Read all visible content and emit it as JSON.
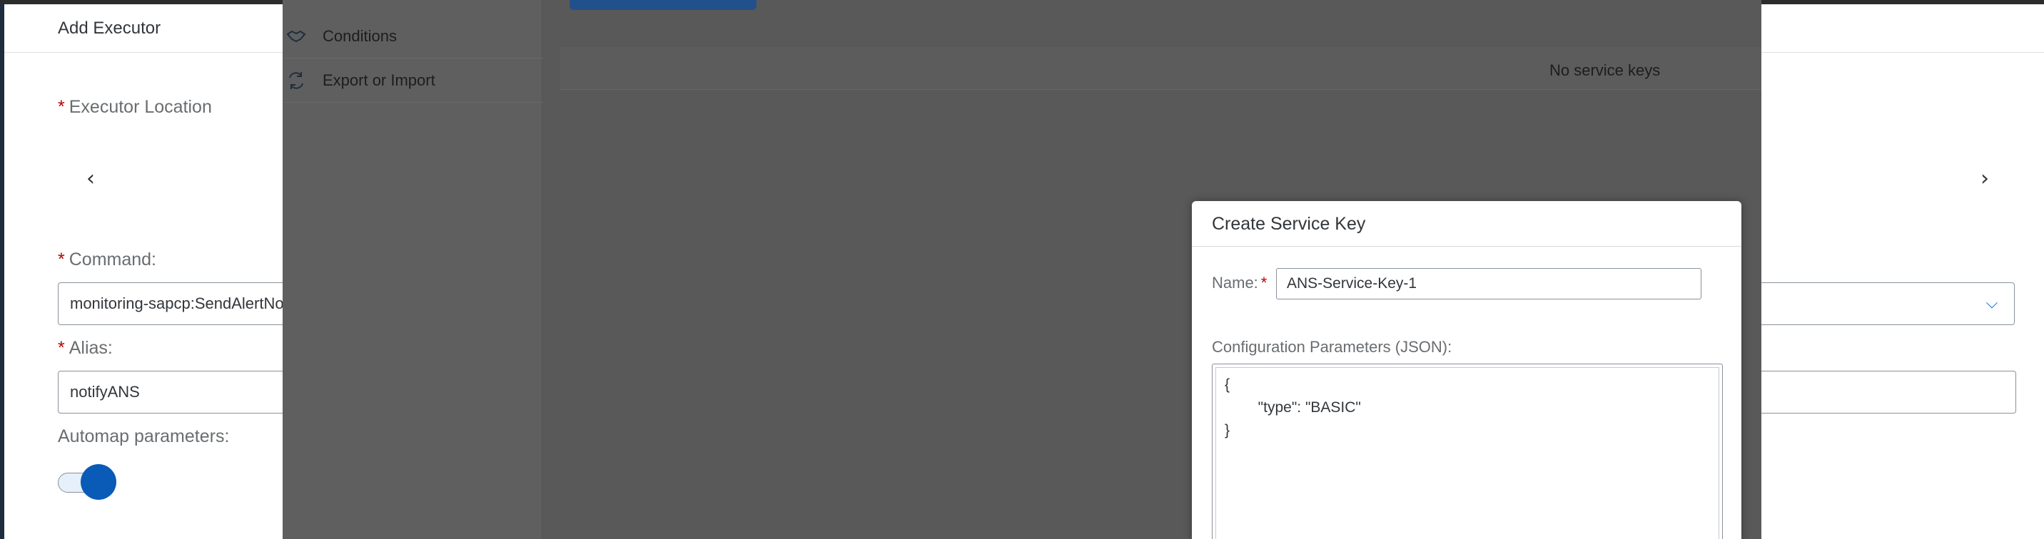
{
  "add_executor": {
    "title": "Add Executor",
    "executor_location_label": "Executor Location",
    "command_label": "Command:",
    "command_value": "monitoring-sapcp:SendAlertNo",
    "alias_label": "Alias:",
    "alias_value": "notifyANS",
    "automap_label": "Automap parameters:",
    "automap_enabled": true,
    "required_mark": "*",
    "prev_arrow": "‹",
    "next_arrow": "›",
    "dropdown_icon": "chevron-down-icon"
  },
  "cockpit": {
    "sidebar": [
      {
        "icon": "handshake-icon",
        "label": "Conditions"
      },
      {
        "icon": "sync-icon",
        "label": "Export or Import"
      }
    ],
    "no_service_keys": "No service keys"
  },
  "create_service_key": {
    "title": "Create Service Key",
    "name_label": "Name:",
    "required_mark": "*",
    "name_value": "ANS-Service-Key-1",
    "config_label": "Configuration Parameters (JSON):",
    "config_value": "{\n        \"type\": \"BASIC\"\n}"
  },
  "colors": {
    "accent": "#0a6ed1",
    "required": "#bb0000",
    "toggle_knob": "#0a5ab8",
    "overlay": "#595959"
  }
}
